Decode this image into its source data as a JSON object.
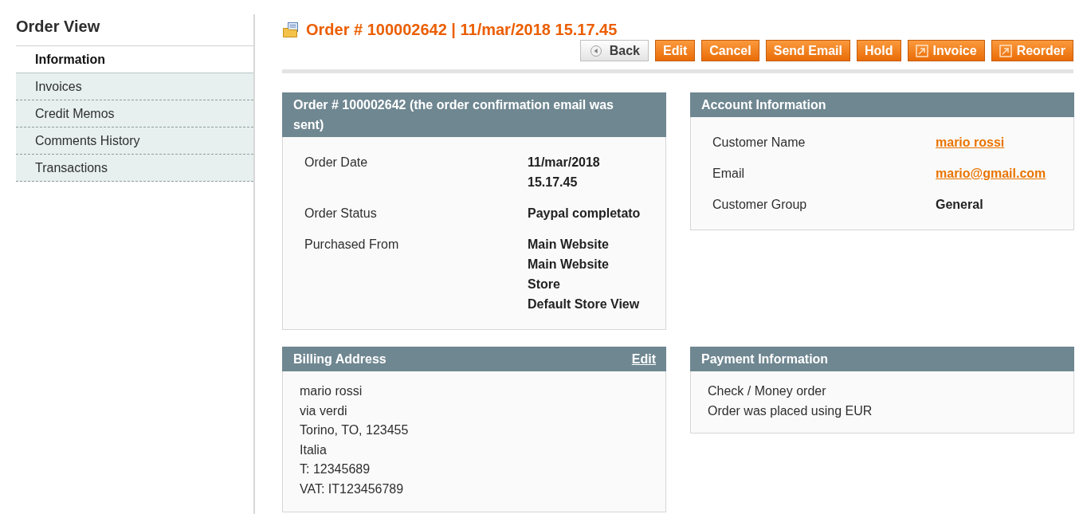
{
  "sidebar": {
    "title": "Order View",
    "items": [
      {
        "label": "Information",
        "selected": true
      },
      {
        "label": "Invoices",
        "selected": false
      },
      {
        "label": "Credit Memos",
        "selected": false
      },
      {
        "label": "Comments History",
        "selected": false
      },
      {
        "label": "Transactions",
        "selected": false
      }
    ]
  },
  "header": {
    "title": "Order # 100002642 | 11/mar/2018 15.17.45",
    "buttons": [
      {
        "label": "Back",
        "kind": "back"
      },
      {
        "label": "Edit",
        "kind": "plain"
      },
      {
        "label": "Cancel",
        "kind": "plain"
      },
      {
        "label": "Send Email",
        "kind": "plain"
      },
      {
        "label": "Hold",
        "kind": "plain"
      },
      {
        "label": "Invoice",
        "kind": "icon"
      },
      {
        "label": "Reorder",
        "kind": "icon"
      }
    ]
  },
  "sections": [
    {
      "kind": "fields",
      "title": "Order # 100002642 (the order confirmation email was sent)",
      "rows": [
        {
          "label": "Order Date",
          "kind": "text",
          "values": [
            "11/mar/2018 15.17.45"
          ]
        },
        {
          "label": "Order Status",
          "kind": "text",
          "values": [
            "Paypal completato"
          ]
        },
        {
          "label": "Purchased From",
          "kind": "text",
          "values": [
            "Main Website",
            "Main Website Store",
            "Default Store View"
          ]
        }
      ]
    },
    {
      "kind": "fields",
      "title": "Account Information",
      "rows": [
        {
          "label": "Customer Name",
          "kind": "link",
          "values": [
            "mario rossi"
          ]
        },
        {
          "label": "Email",
          "kind": "link",
          "values": [
            "mario@gmail.com"
          ]
        },
        {
          "label": "Customer Group",
          "kind": "text",
          "values": [
            "General"
          ]
        }
      ]
    },
    {
      "kind": "lines",
      "title": "Billing Address",
      "action": "Edit",
      "lines": [
        "mario rossi",
        "via verdi",
        "Torino, TO, 123455",
        "Italia",
        "T: 12345689",
        "VAT: IT123456789"
      ]
    },
    {
      "kind": "lines",
      "title": "Payment Information",
      "lines": [
        "Check / Money order",
        "Order was placed using EUR"
      ]
    }
  ]
}
